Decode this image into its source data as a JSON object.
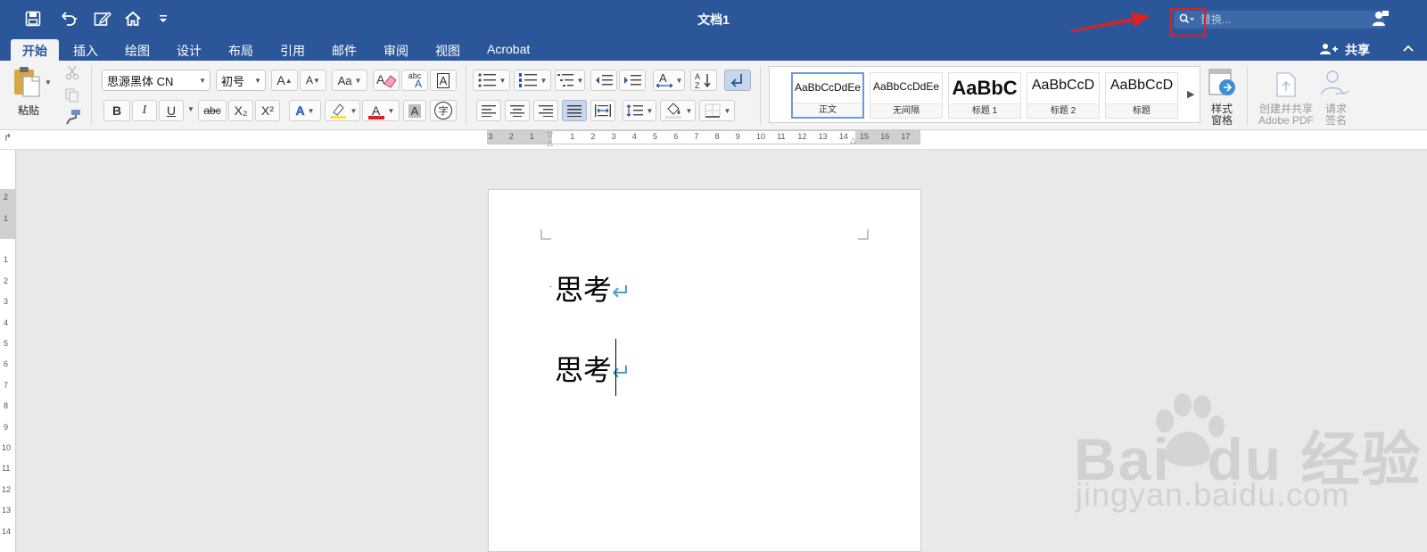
{
  "titlebar": {
    "doc_title": "文档1",
    "search_placeholder": "替换...",
    "qa_icons": [
      "save-icon",
      "undo-icon",
      "edit-icon",
      "home-icon",
      "customize-icon"
    ]
  },
  "tabs": [
    "开始",
    "插入",
    "绘图",
    "设计",
    "布局",
    "引用",
    "邮件",
    "审阅",
    "视图",
    "Acrobat"
  ],
  "share_label": "共享",
  "ribbon": {
    "paste_label": "粘贴",
    "font_name": "思源黑体 CN",
    "font_size": "初号",
    "bold": "B",
    "italic": "I",
    "underline": "U",
    "strike": "abc",
    "subscript": "X₂",
    "superscript": "X²",
    "grow_font": "A",
    "shrink_font": "A",
    "change_case": "Aa",
    "phonetic": "abc",
    "border_char": "A",
    "font_color": "A",
    "shade_char": "A",
    "enclose": "字",
    "styles": [
      {
        "preview": "AaBbCcDdEe",
        "name": "正文",
        "selected": true
      },
      {
        "preview": "AaBbCcDdEe",
        "name": "无间隔",
        "selected": false
      },
      {
        "preview": "AaBbC",
        "name": "标题 1",
        "selected": false
      },
      {
        "preview": "AaBbCcD",
        "name": "标题 2",
        "selected": false
      },
      {
        "preview": "AaBbCcD",
        "name": "标题",
        "selected": false
      }
    ],
    "style_pane_label_1": "样式",
    "style_pane_label_2": "窗格",
    "adobe_label_1": "创建并共享",
    "adobe_label_2": "Adobe PDF",
    "request_label_1": "请求",
    "request_label_2": "签名"
  },
  "ruler": {
    "h_left_labels": [
      "3",
      "2",
      "1"
    ],
    "h_labels": [
      "1",
      "2",
      "3",
      "4",
      "5",
      "6",
      "7",
      "8",
      "9",
      "10",
      "11",
      "12",
      "13",
      "14",
      "15",
      "16",
      "17"
    ],
    "v_top_labels": [
      "2",
      "1"
    ],
    "v_labels": [
      "1",
      "2",
      "3",
      "4",
      "5",
      "6",
      "7",
      "8",
      "9",
      "10",
      "11",
      "12",
      "13",
      "14"
    ]
  },
  "document": {
    "paragraphs": [
      "思考",
      "思考"
    ],
    "return_mark": "↵"
  },
  "watermark": {
    "brand": "Bai  du 经验",
    "url": "jingyan.baidu.com"
  },
  "colors": {
    "title_blue": "#2b579a",
    "accent_red": "#e02020",
    "return_mark": "#4f9ed8"
  }
}
